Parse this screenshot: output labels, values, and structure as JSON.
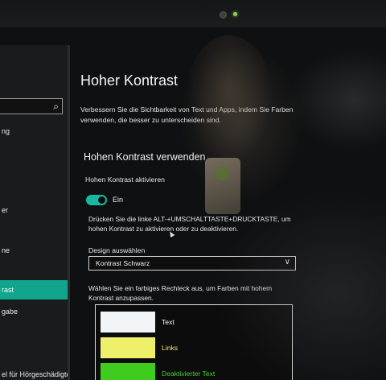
{
  "sidebar": {
    "items": [
      {
        "label": "ng",
        "active": false
      },
      {
        "label": "er",
        "active": false
      },
      {
        "label": "ne",
        "active": false
      },
      {
        "label": "rast",
        "active": true
      },
      {
        "label": "gabe",
        "active": false
      },
      {
        "label": "el für Hörgeschädigte",
        "active": false
      }
    ]
  },
  "page": {
    "title": "Hoher Kontrast",
    "description": "Verbessern Sie die Sichtbarkeit von Text und Apps, indem Sie Farben verwenden, die besser zu unterscheiden sind.",
    "section_heading": "Hohen Kontrast verwenden",
    "toggle_label": "Hohen Kontrast aktivieren",
    "toggle_state": "Ein",
    "shortcut_hint": "Drücken Sie die linke ALT-+UMSCHALTTASTE+DRUCKTASTE, um hohen Kontrast zu aktivieren oder zu deaktivieren.",
    "design_label": "Design auswählen",
    "design_value": "Kontrast Schwarz",
    "pick_description": "Wählen Sie ein farbiges Rechteck aus, um Farben mit hohem Kontrast anzupassen."
  },
  "swatches": [
    {
      "label": "Text",
      "color": "#f2f5f7",
      "text_color": "#ffffff"
    },
    {
      "label": "Links",
      "color": "#eef06a",
      "text_color": "#f0f06b"
    },
    {
      "label": "Deaktivierter Text",
      "color": "#3fcc1e",
      "text_color": "#45d12c"
    }
  ],
  "colors": {
    "accent": "#12a58e",
    "toggle": "#18b8a0"
  }
}
